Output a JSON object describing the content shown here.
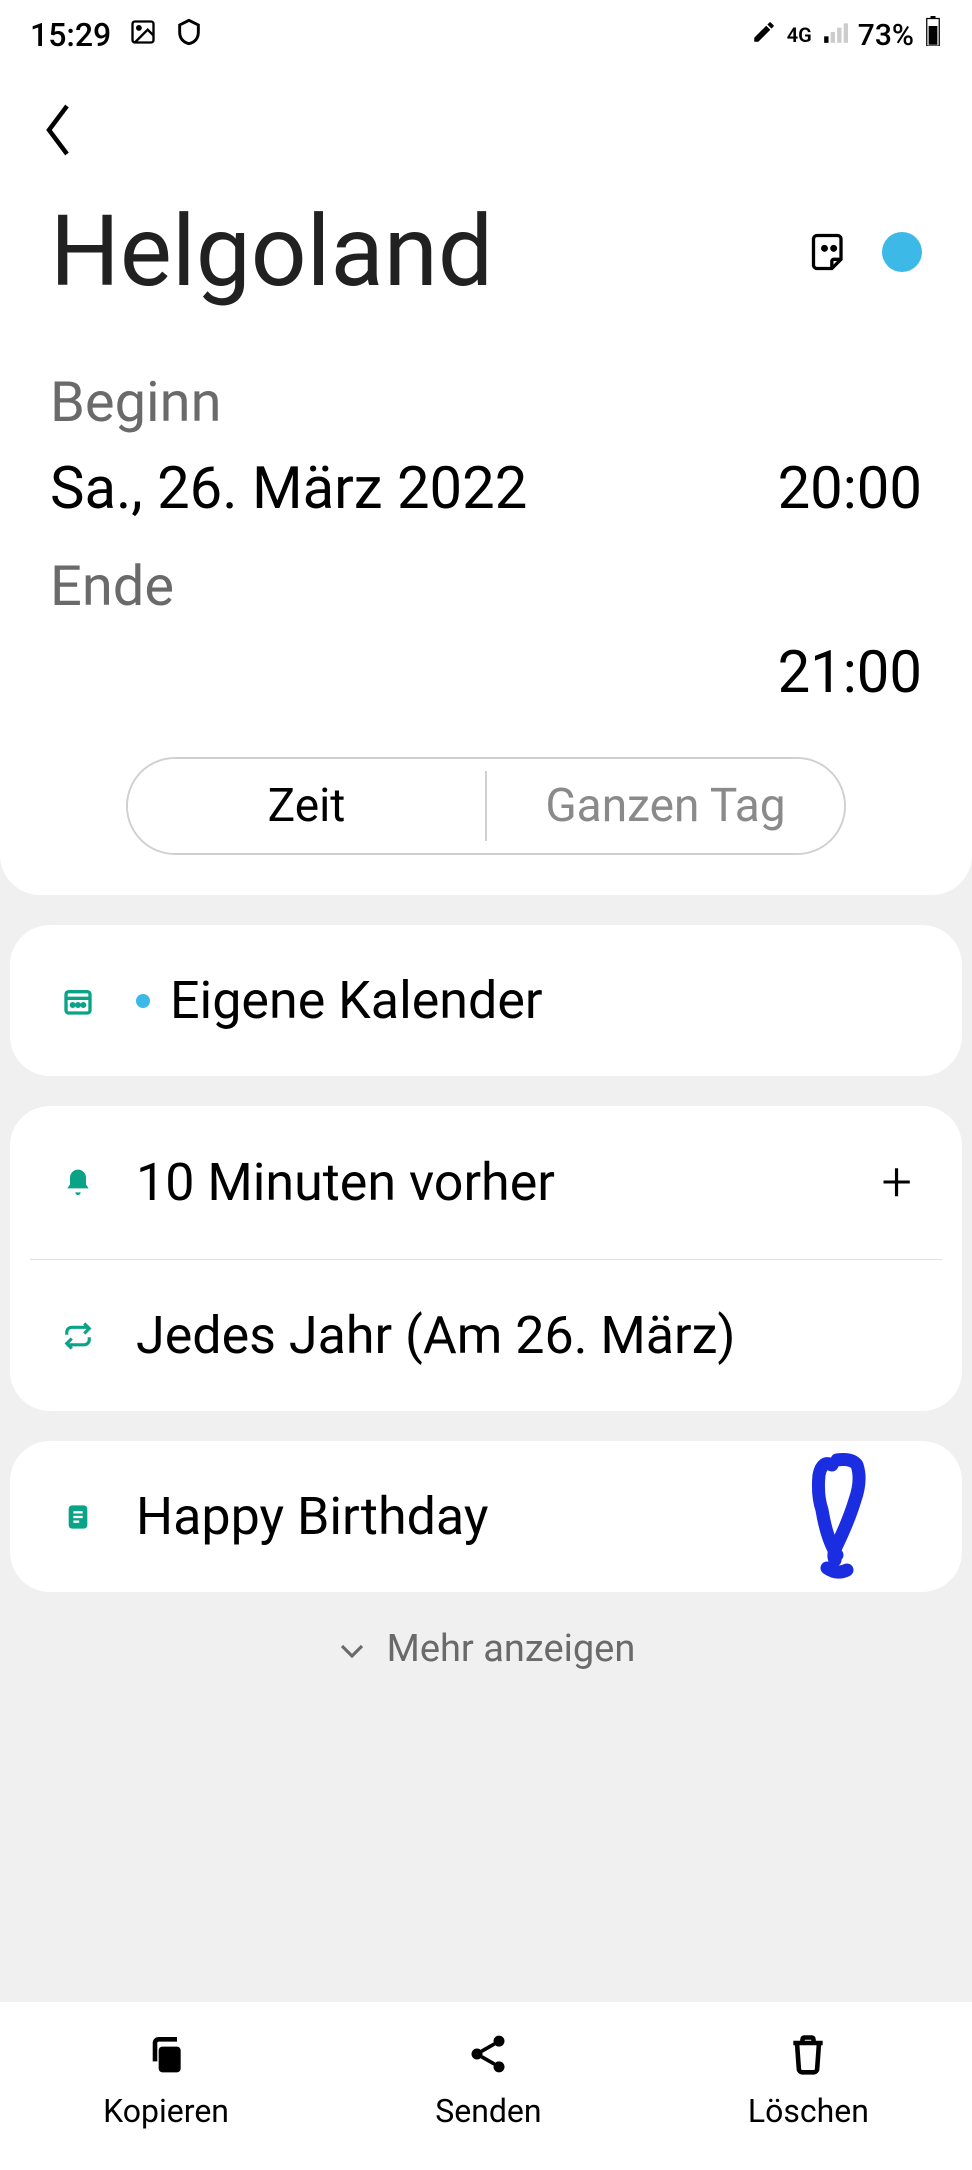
{
  "statusBar": {
    "time": "15:29",
    "network": "4G",
    "battery": "73%"
  },
  "event": {
    "title": "Helgoland",
    "colorAccent": "#3db9e8"
  },
  "timeSection": {
    "startLabel": "Beginn",
    "startDate": "Sa., 26. März 2022",
    "startTime": "20:00",
    "endLabel": "Ende",
    "endTime": "21:00"
  },
  "toggle": {
    "timeLabel": "Zeit",
    "allDayLabel": "Ganzen Tag"
  },
  "calendar": {
    "label": "Eigene Kalender"
  },
  "reminder": {
    "label": "10 Minuten vorher"
  },
  "repeat": {
    "label": "Jedes Jahr (Am 26. März)"
  },
  "notes": {
    "label": "Happy Birthday"
  },
  "more": {
    "label": "Mehr anzeigen"
  },
  "bottomBar": {
    "copy": "Kopieren",
    "send": "Senden",
    "delete": "Löschen"
  }
}
